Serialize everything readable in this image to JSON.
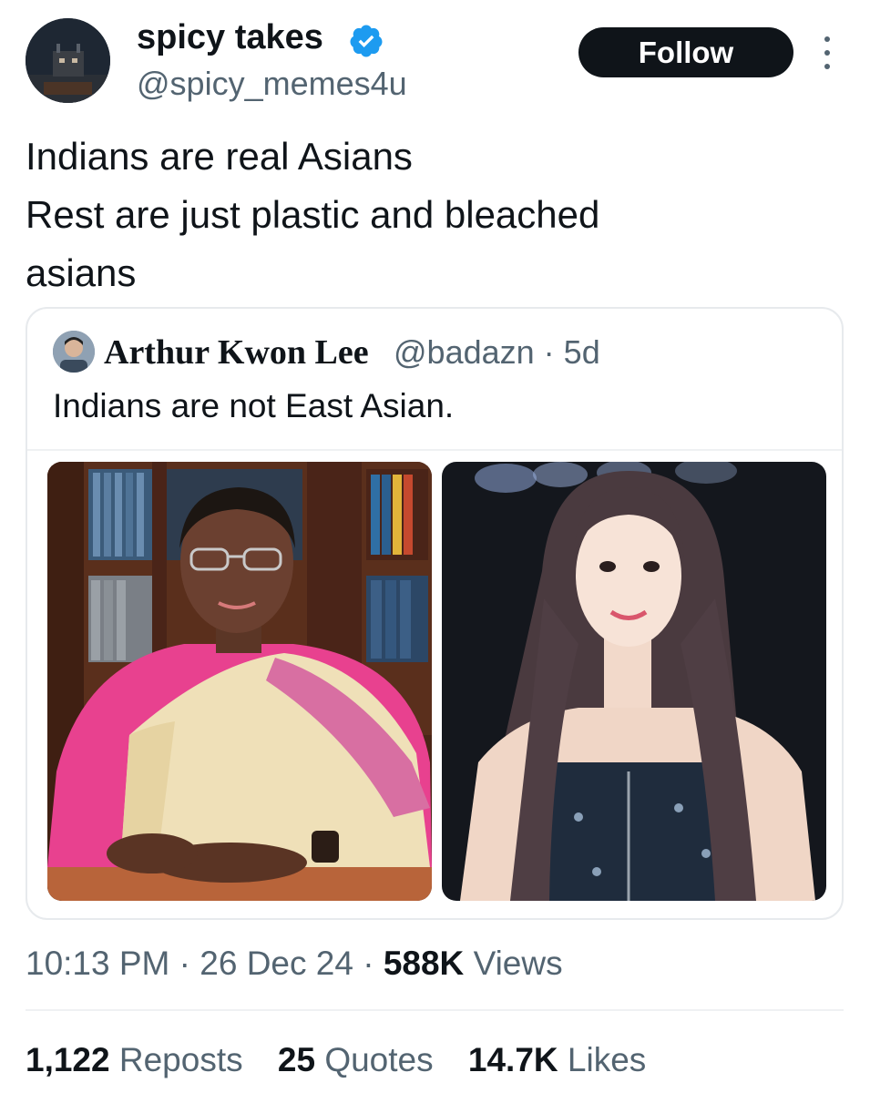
{
  "post": {
    "display_name": "spicy takes",
    "handle": "@spicy_memes4u",
    "follow_label": "Follow",
    "text_lines": [
      "Indians are real Asians",
      "Rest are just plastic and bleached",
      "asians"
    ]
  },
  "quote": {
    "name": "Arthur Kwon Lee",
    "handle": "@badazn",
    "age": "5d",
    "text": "Indians are not East Asian."
  },
  "meta": {
    "time": "10:13 PM",
    "date": "26 Dec 24",
    "views_count": "588K",
    "views_label": "Views"
  },
  "stats": {
    "reposts_count": "1,122",
    "reposts_label": "Reposts",
    "quotes_count": "25",
    "quotes_label": "Quotes",
    "likes_count": "14.7K",
    "likes_label": "Likes"
  },
  "colors": {
    "text": "#0f1419",
    "secondary": "#536471",
    "verified": "#1d9bf0",
    "follow_bg": "#0f1419"
  }
}
